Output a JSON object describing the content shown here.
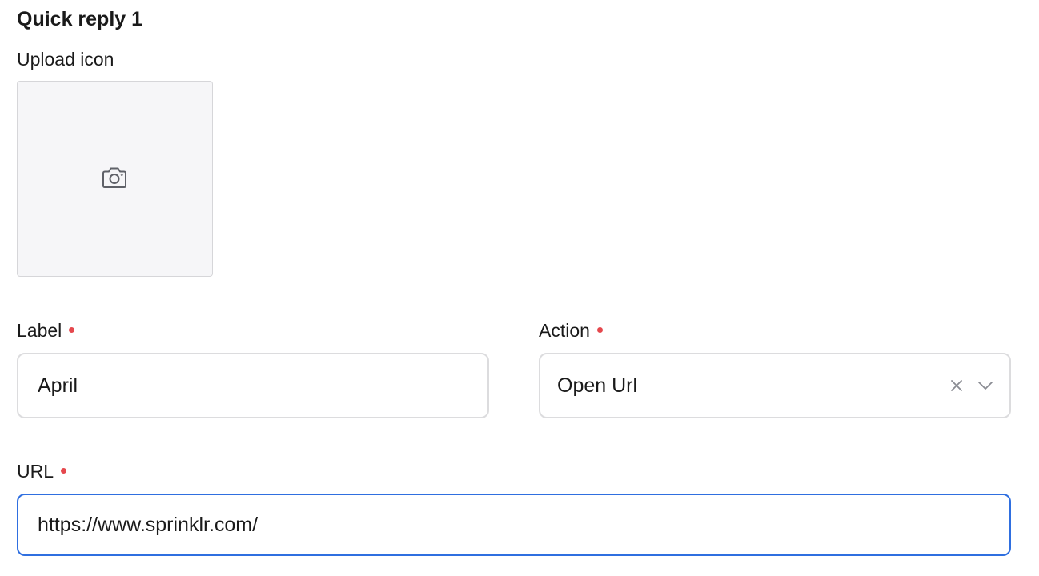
{
  "section": {
    "title": "Quick reply 1"
  },
  "upload": {
    "label": "Upload icon",
    "icon": "camera-icon"
  },
  "label_field": {
    "label": "Label",
    "value": "April",
    "required": true
  },
  "action_field": {
    "label": "Action",
    "value": "Open Url",
    "required": true,
    "clear_icon": "close-icon",
    "dropdown_icon": "chevron-down-icon"
  },
  "url_field": {
    "label": "URL",
    "value": "https://www.sprinklr.com/",
    "required": true,
    "focused": true
  },
  "colors": {
    "required_dot": "#e5484d",
    "focus_border": "#2f6fe0",
    "input_border": "#dcdcde",
    "upload_bg": "#f6f6f8"
  }
}
